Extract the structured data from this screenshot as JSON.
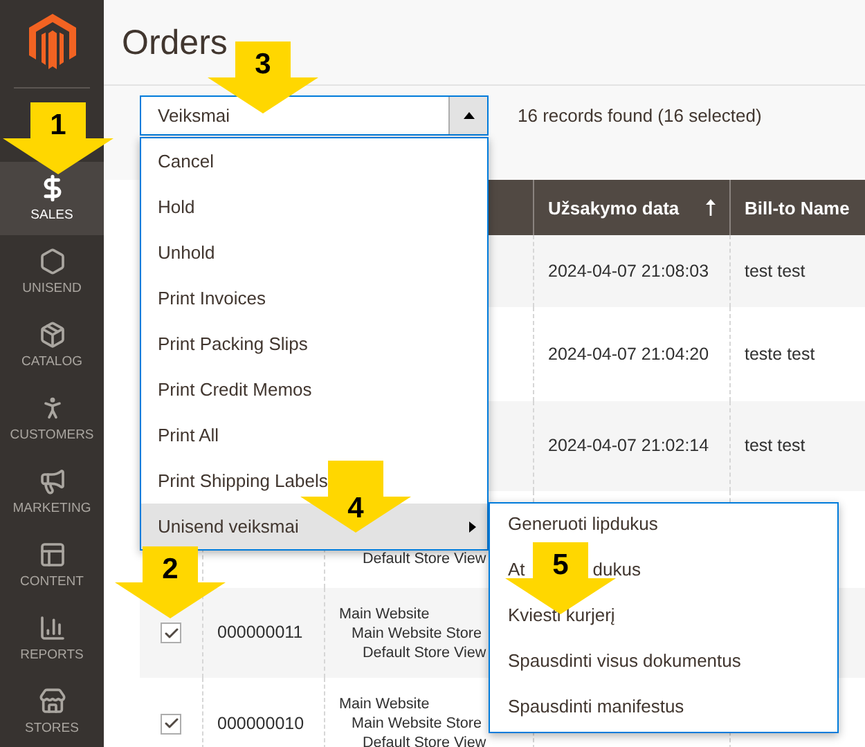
{
  "sidebar": {
    "items": [
      {
        "label": "SALES",
        "selected": true
      },
      {
        "label": "UNISEND",
        "selected": false
      },
      {
        "label": "CATALOG",
        "selected": false
      },
      {
        "label": "CUSTOMERS",
        "selected": false
      },
      {
        "label": "MARKETING",
        "selected": false
      },
      {
        "label": "CONTENT",
        "selected": false
      },
      {
        "label": "REPORTS",
        "selected": false
      },
      {
        "label": "STORES",
        "selected": false
      }
    ]
  },
  "page_title": "Orders",
  "actions_select": {
    "value": "Veiksmai",
    "expanded": true,
    "options": [
      {
        "label": "Cancel",
        "selected": false
      },
      {
        "label": "Hold",
        "selected": false
      },
      {
        "label": "Unhold",
        "selected": false
      },
      {
        "label": "Print Invoices",
        "selected": false
      },
      {
        "label": "Print Packing Slips",
        "selected": false
      },
      {
        "label": "Print Credit Memos",
        "selected": false
      },
      {
        "label": "Print All",
        "selected": false
      },
      {
        "label": "Print Shipping Labels",
        "selected": false
      },
      {
        "label": "Unisend veiksmai",
        "selected": true,
        "submenu": [
          [
            "Generuoti lipdukus"
          ],
          [
            "At",
            "dukus"
          ],
          [
            "Kviesti kurjerį"
          ],
          [
            "Spausdinti visus dokumentus"
          ],
          [
            "Spausdinti manifestus"
          ]
        ]
      }
    ]
  },
  "records_found": "16 records found (16 selected)",
  "table": {
    "columns": [
      {
        "label": "Užsakymo data",
        "sorted": true
      },
      {
        "label": "Bill-to Name"
      }
    ],
    "rows": [
      {
        "date": "2024-04-07 21:08:03",
        "name": "test test"
      },
      {
        "date": "2024-04-07 21:04:20",
        "name": "teste test"
      },
      {
        "date": "2024-04-07 21:02:14",
        "name": "test test"
      },
      {
        "store": [
          "Default Store View"
        ]
      },
      {
        "checked": true,
        "id": "000000011",
        "store": [
          "Main Website",
          "Main Website Store",
          "Default Store View"
        ]
      },
      {
        "checked": true,
        "id": "000000010",
        "store": [
          "Main Website",
          "Main Website Store",
          "Default Store View"
        ]
      }
    ]
  },
  "callouts": [
    "1",
    "2",
    "3",
    "4",
    "5"
  ]
}
